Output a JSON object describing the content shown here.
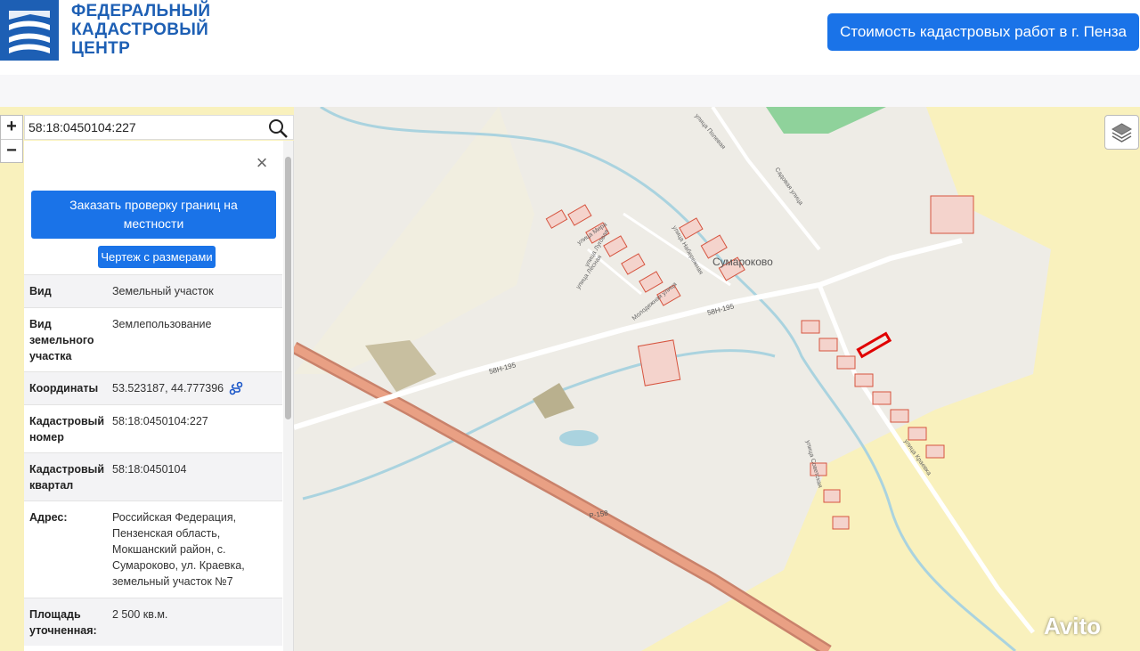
{
  "header": {
    "logo_lines": [
      "ФЕДЕРАЛЬНЫЙ",
      "КАДАСТРОВЫЙ",
      "ЦЕНТР"
    ],
    "cta_label": "Стоимость кадастровых работ в г. Пенза",
    "brand_color": "#1d5fb4",
    "accent_color": "#1a73e8"
  },
  "map": {
    "search_value": "58:18:0450104:227",
    "zoom_in": "+",
    "zoom_out": "−",
    "labels": {
      "village": "Сумароково",
      "road_58n195_a": "58Н-195",
      "road_58n195_b": "58Н-195",
      "road_r158": "Р-158",
      "street_lesnaya": "улица Лесная",
      "street_molodezhnaya": "Молодежная улица",
      "street_sadovaya": "Садовая улица",
      "street_polevaya": "улица Полевая",
      "street_naberezhnaya": "улица Набережная",
      "street_mira": "улица Мира",
      "street_sovetskaya": "улица Советская",
      "street_kraevka": "улица Краевка",
      "street_lugovaya": "улица Луговая"
    },
    "watermark": "Avito"
  },
  "panel": {
    "close": "×",
    "order_label": "Заказать проверку границ на местности",
    "sketch_label": "Чертеж с размерами",
    "rows": [
      {
        "key": "Вид",
        "value": "Земельный участок"
      },
      {
        "key": "Вид земельного участка",
        "value": "Землепользование"
      },
      {
        "key": "Координаты",
        "value": "53.523187, 44.777396"
      },
      {
        "key": "Кадастровый номер",
        "value": "58:18:0450104:227"
      },
      {
        "key": "Кадастровый квартал",
        "value": "58:18:0450104"
      },
      {
        "key": "Адрес:",
        "value": "Российская Федерация, Пензенская область, Мокшанский район, с. Сумароково, ул. Краевка, земельный участок №7"
      },
      {
        "key": "Площадь уточненная:",
        "value": "2 500 кв.м."
      }
    ]
  }
}
